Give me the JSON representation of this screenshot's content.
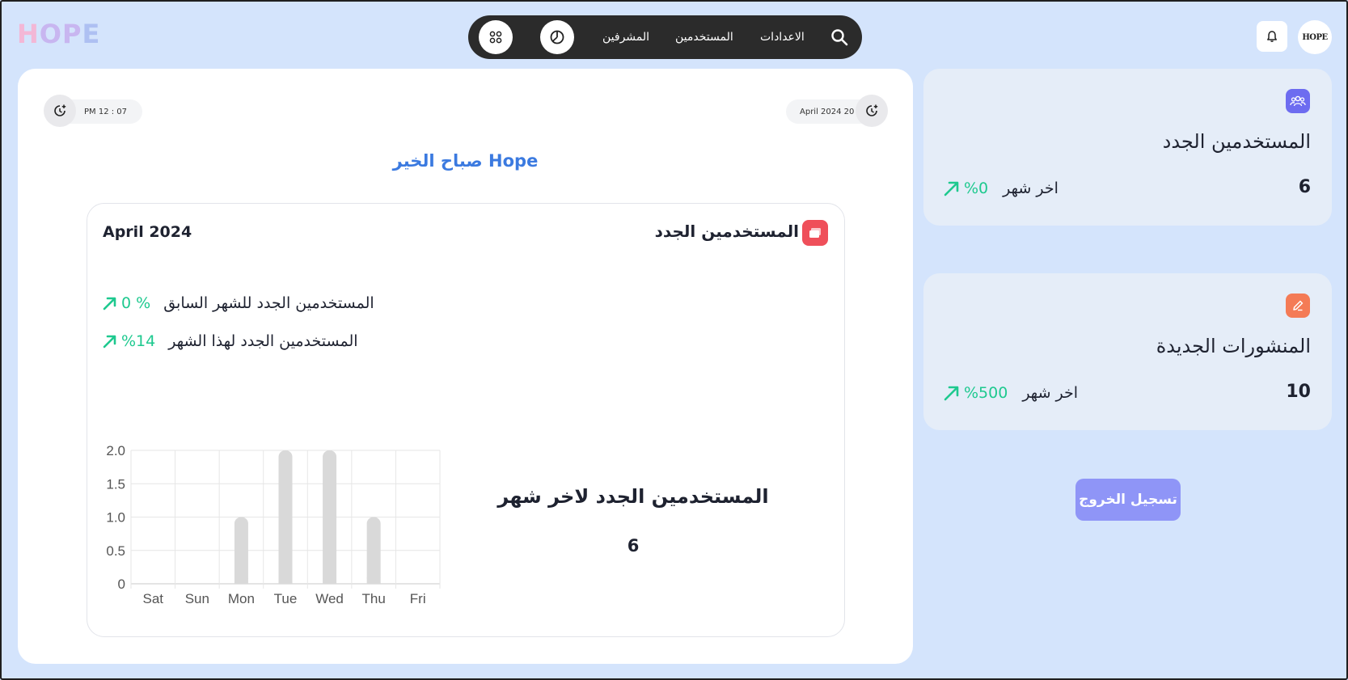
{
  "logo": {
    "part1": "H",
    "part2": "OP",
    "part3": "E"
  },
  "nav": {
    "settings_label": "الاعدادات",
    "users_label": "المستخدمين",
    "supervisors_label": "المشرفين"
  },
  "avatar_text": "HOPE",
  "main": {
    "time": "PM 12 : 07",
    "date": "April 2024 20",
    "greeting": "صباح الخير Hope",
    "card": {
      "title": "المستخدمين الجدد",
      "month": "April 2024",
      "prev_month_label": "المستخدمين الجدد للشهر السابق",
      "prev_month_pct": "0 %",
      "this_month_label": "المستخدمين الجدد لهذا الشهر",
      "this_month_pct": "%14",
      "last_month_heading": "المستخدمين الجدد لاخر شهر",
      "last_month_count": "6"
    }
  },
  "side": {
    "users": {
      "title": "المستخدمين الجدد",
      "count": "6",
      "period": "اخر شهر",
      "pct": "%0",
      "icon_color": "#6d6cf0"
    },
    "posts": {
      "title": "المنشورات الجديدة",
      "count": "10",
      "period": "اخر شهر",
      "pct": "%500",
      "icon_color": "#f47b56"
    }
  },
  "logout_label": "تسجيل الخروج",
  "colors": {
    "accent_green": "#1ec98f",
    "greeting_blue": "#3b7ae0",
    "bar_gray": "#d9d9d9"
  },
  "chart_data": {
    "type": "bar",
    "categories": [
      "Sat",
      "Sun",
      "Mon",
      "Tue",
      "Wed",
      "Thu",
      "Fri"
    ],
    "values": [
      0,
      0,
      1,
      2,
      2,
      1,
      0
    ],
    "ylim": [
      0,
      2
    ],
    "yticks": [
      "0",
      "0.5",
      "1.0",
      "1.5",
      "2.0"
    ],
    "grid": true
  }
}
